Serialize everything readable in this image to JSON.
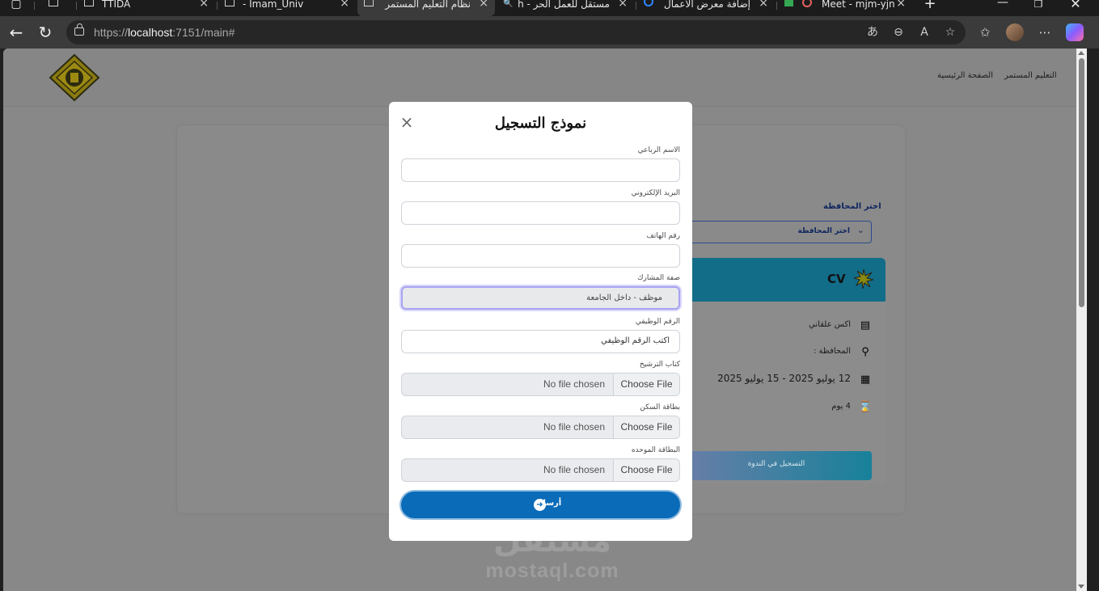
{
  "browser": {
    "tabs": [
      {
        "label": "",
        "active": false
      },
      {
        "label": "TTIDA",
        "active": false
      },
      {
        "label": "- Imam_Univ",
        "active": false
      },
      {
        "label": "نظام التعليم المستمر",
        "active": true
      },
      {
        "label": "مستقل للعمل الحر - h",
        "active": false
      },
      {
        "label": "إضافة معرض الأعمال",
        "active": false
      },
      {
        "label": "Meet - mjm-yjn",
        "active": false
      }
    ],
    "url_prefix": "https://",
    "url_host": "localhost",
    "url_rest": ":7151/main#"
  },
  "site": {
    "nav": {
      "continuing_education": "التعليم المستمر",
      "home": "الصفحة الرئيسية"
    },
    "governorate_label": "اختر المحافظة",
    "governorate_select": "اختر المحافظة",
    "course": {
      "title": "CV",
      "trainer": "اكس علقاني",
      "governorate": "المحافظة :",
      "dates": "12 يوليو 2025 - 15 يوليو 2025",
      "duration": "4 يوم",
      "register_button": "التسجيل في الندوة"
    },
    "watermark_ar": "مستقل",
    "watermark_en": "mostaql.com"
  },
  "modal": {
    "title": "نموذج التسجيل",
    "fields": {
      "full_name_label": "الاسم الرباعي",
      "email_label": "البريد الإلكتروني",
      "phone_label": "رقم الهاتف",
      "participant_type_label": "صفة المشارك",
      "participant_type_value": "موظف - داخل الجامعة",
      "employee_id_label": "الرقم الوظيفي",
      "employee_id_placeholder": "اكتب الرقم الوظيفي",
      "nomination_letter_label": "كتاب الترشيح",
      "residence_card_label": "بطاقة السكن",
      "unified_card_label": "البطاقة الموحده",
      "choose_file": "Choose File",
      "no_file": "No file chosen"
    },
    "submit_label": "أرسال"
  }
}
